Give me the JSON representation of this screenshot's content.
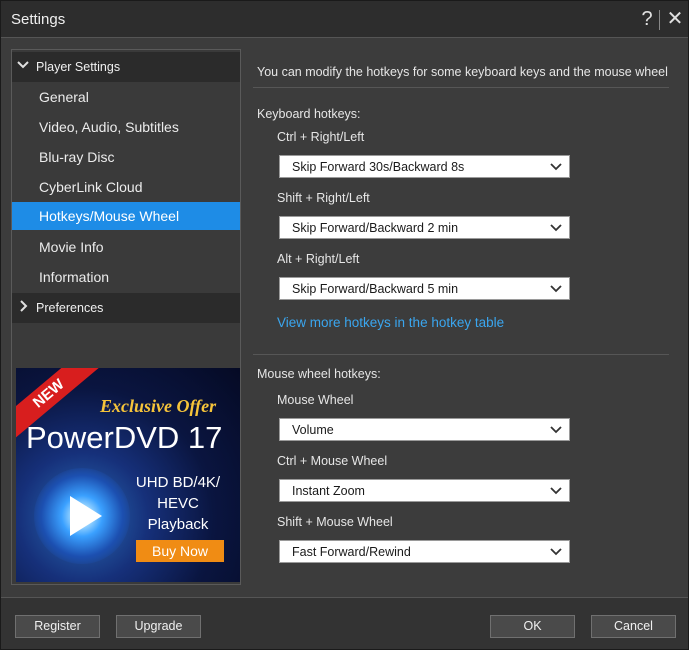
{
  "window": {
    "title": "Settings",
    "help_glyph": "?",
    "close_glyph": "✕"
  },
  "sidebar": {
    "groups": [
      {
        "label": "Player Settings",
        "expanded": true
      },
      {
        "label": "Preferences",
        "expanded": false
      }
    ],
    "items": [
      {
        "label": "General"
      },
      {
        "label": "Video, Audio, Subtitles"
      },
      {
        "label": "Blu-ray Disc"
      },
      {
        "label": "CyberLink Cloud"
      },
      {
        "label": "Hotkeys/Mouse Wheel",
        "selected": true
      },
      {
        "label": "Movie Info"
      },
      {
        "label": "Information"
      }
    ],
    "ad": {
      "ribbon": "NEW",
      "offer": "Exclusive Offer",
      "product": "PowerDVD 17",
      "features": [
        "UHD BD/4K/",
        "HEVC",
        "Playback"
      ],
      "buy": "Buy Now"
    }
  },
  "main": {
    "intro": "You can modify the hotkeys for some keyboard keys and the mouse wheel",
    "keyboard": {
      "heading": "Keyboard hotkeys:",
      "fields": [
        {
          "label": "Ctrl + Right/Left",
          "value": "Skip Forward 30s/Backward 8s"
        },
        {
          "label": "Shift + Right/Left",
          "value": "Skip Forward/Backward 2 min"
        },
        {
          "label": "Alt + Right/Left",
          "value": "Skip Forward/Backward 5 min"
        }
      ],
      "link": "View more hotkeys in the hotkey table"
    },
    "mouse": {
      "heading": "Mouse wheel hotkeys:",
      "fields": [
        {
          "label": "Mouse Wheel",
          "value": "Volume"
        },
        {
          "label": "Ctrl + Mouse Wheel",
          "value": "Instant Zoom"
        },
        {
          "label": "Shift + Mouse Wheel",
          "value": "Fast Forward/Rewind"
        }
      ]
    }
  },
  "footer": {
    "register": "Register",
    "upgrade": "Upgrade",
    "ok": "OK",
    "cancel": "Cancel"
  },
  "colors": {
    "accent": "#1e8ce6",
    "link": "#3aa6ef",
    "background": "#3c3c3c"
  }
}
